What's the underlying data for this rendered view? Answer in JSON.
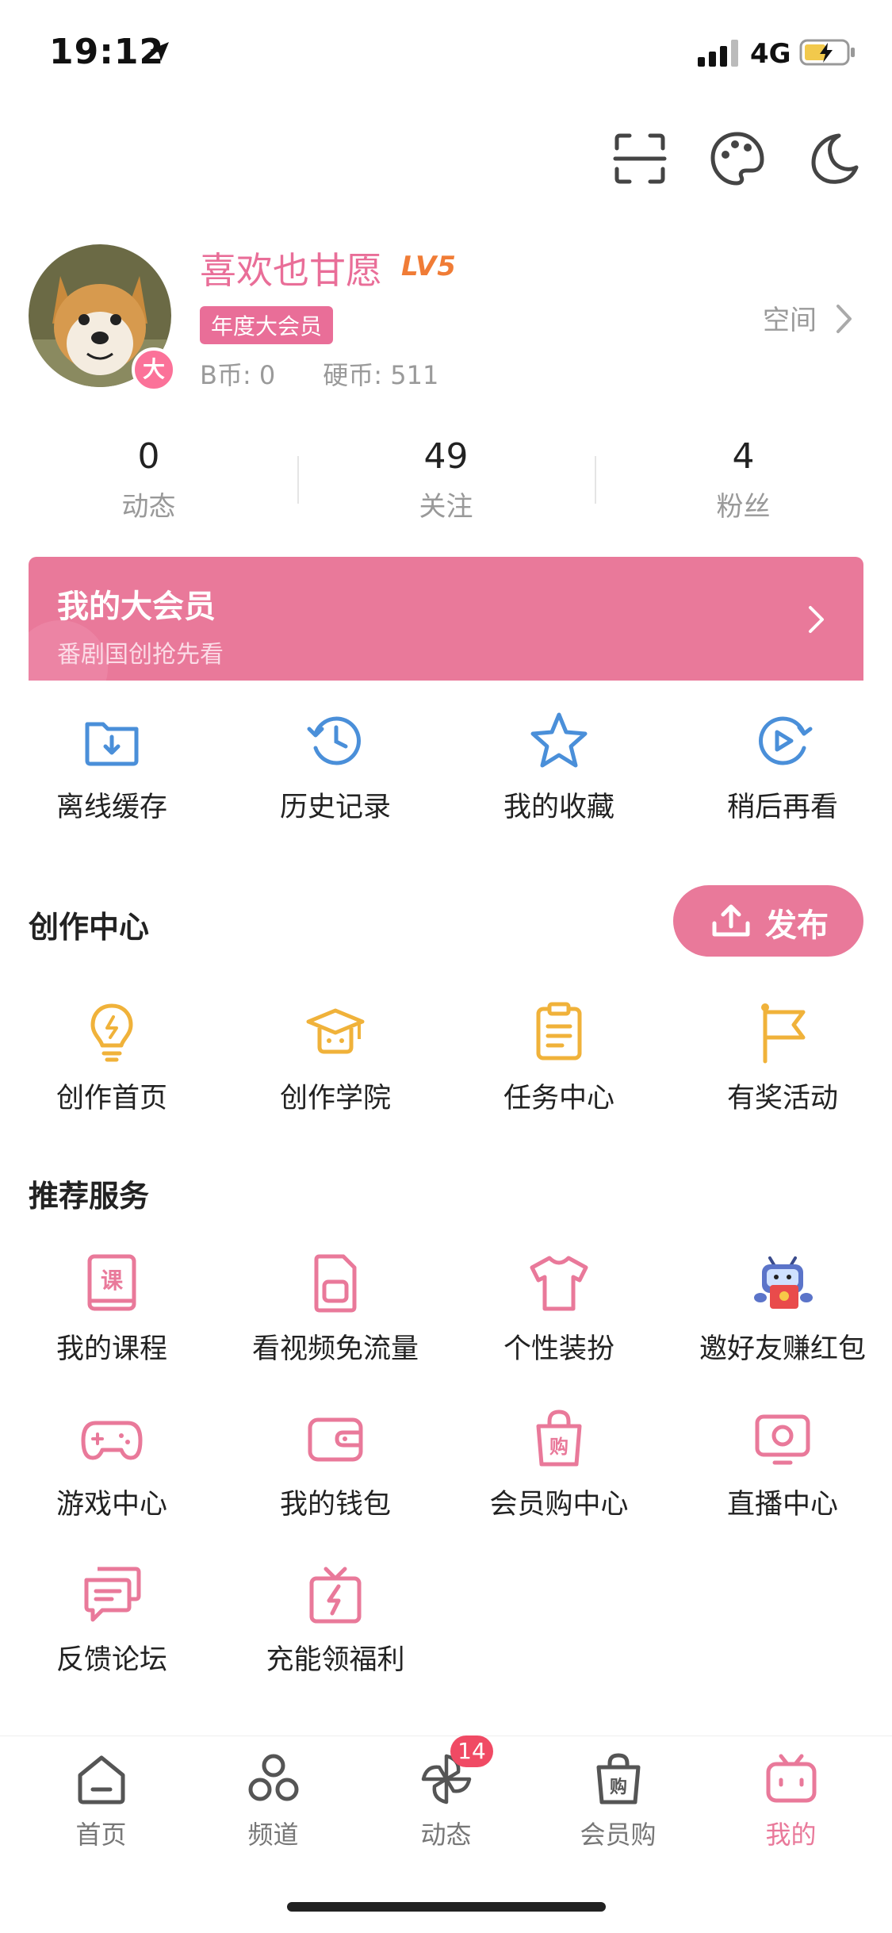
{
  "status_bar": {
    "time": "19:12",
    "network": "4G"
  },
  "profile": {
    "username": "喜欢也甘愿",
    "level": "LV5",
    "vip_tag": "年度大会员",
    "avatar_badge": "大",
    "b_coin": "B币: 0",
    "coins": "硬币: 511",
    "space_label": "空间"
  },
  "stats": [
    {
      "value": "0",
      "label": "动态"
    },
    {
      "value": "49",
      "label": "关注"
    },
    {
      "value": "4",
      "label": "粉丝"
    }
  ],
  "vip_banner": {
    "title": "我的大会员",
    "subtitle": "番剧国创抢先看"
  },
  "quick_actions": [
    {
      "label": "离线缓存",
      "icon": "download-folder-icon"
    },
    {
      "label": "历史记录",
      "icon": "history-clock-icon"
    },
    {
      "label": "我的收藏",
      "icon": "star-icon"
    },
    {
      "label": "稍后再看",
      "icon": "play-later-icon"
    }
  ],
  "creation_center": {
    "title": "创作中心",
    "publish_label": "发布",
    "items": [
      {
        "label": "创作首页",
        "icon": "lightbulb-icon"
      },
      {
        "label": "创作学院",
        "icon": "graduation-cap-icon"
      },
      {
        "label": "任务中心",
        "icon": "clipboard-icon"
      },
      {
        "label": "有奖活动",
        "icon": "flag-icon"
      }
    ]
  },
  "recommended": {
    "title": "推荐服务",
    "items": [
      {
        "label": "我的课程",
        "icon": "course-book-icon"
      },
      {
        "label": "看视频免流量",
        "icon": "sim-card-icon"
      },
      {
        "label": "个性装扮",
        "icon": "tshirt-icon"
      },
      {
        "label": "邀好友赚红包",
        "icon": "mascot-red-envelope-icon"
      },
      {
        "label": "游戏中心",
        "icon": "gamepad-icon"
      },
      {
        "label": "我的钱包",
        "icon": "wallet-icon"
      },
      {
        "label": "会员购中心",
        "icon": "shopping-bag-icon"
      },
      {
        "label": "直播中心",
        "icon": "live-tv-icon"
      },
      {
        "label": "反馈论坛",
        "icon": "chat-bubbles-icon"
      },
      {
        "label": "充能领福利",
        "icon": "gift-charge-icon"
      }
    ]
  },
  "bottom_nav": [
    {
      "label": "首页",
      "icon": "home-icon"
    },
    {
      "label": "频道",
      "icon": "channels-icon"
    },
    {
      "label": "动态",
      "icon": "pinwheel-icon",
      "badge": "14"
    },
    {
      "label": "会员购",
      "icon": "shopping-bag-icon"
    },
    {
      "label": "我的",
      "icon": "tv-mine-icon",
      "active": true
    }
  ],
  "colors": {
    "accent_pink": "#e9799a",
    "text_gray": "#999999",
    "creation_yellow": "#f0b23a",
    "quick_blue": "#4a8fd9",
    "level_orange": "#f07c36"
  }
}
